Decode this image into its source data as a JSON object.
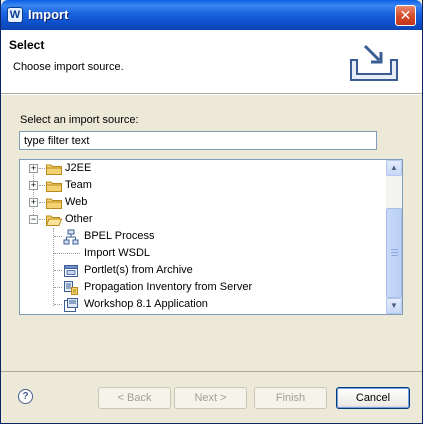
{
  "window": {
    "title": "Import"
  },
  "banner": {
    "title": "Select",
    "description": "Choose import source."
  },
  "source": {
    "label": "Select an import source:",
    "filter_value": "type filter text"
  },
  "tree": {
    "folders": [
      {
        "label": "J2EE",
        "expanded": false
      },
      {
        "label": "Team",
        "expanded": false
      },
      {
        "label": "Web",
        "expanded": false
      },
      {
        "label": "Other",
        "expanded": true
      }
    ],
    "items": [
      {
        "label": "BPEL Process",
        "icon": "bpel-process-icon"
      },
      {
        "label": "Import WSDL",
        "icon": ""
      },
      {
        "label": "Portlet(s) from Archive",
        "icon": "portlet-archive-icon"
      },
      {
        "label": "Propagation Inventory from Server",
        "icon": "propagation-server-icon"
      },
      {
        "label": "Workshop 8.1 Application",
        "icon": "workshop-application-icon"
      }
    ]
  },
  "buttons": {
    "back": "< Back",
    "next": "Next >",
    "finish": "Finish",
    "cancel": "Cancel"
  },
  "colors": {
    "titlebar": "#0d4ec8",
    "dialog_bg": "#ece9d8",
    "accent": "#003c74"
  }
}
